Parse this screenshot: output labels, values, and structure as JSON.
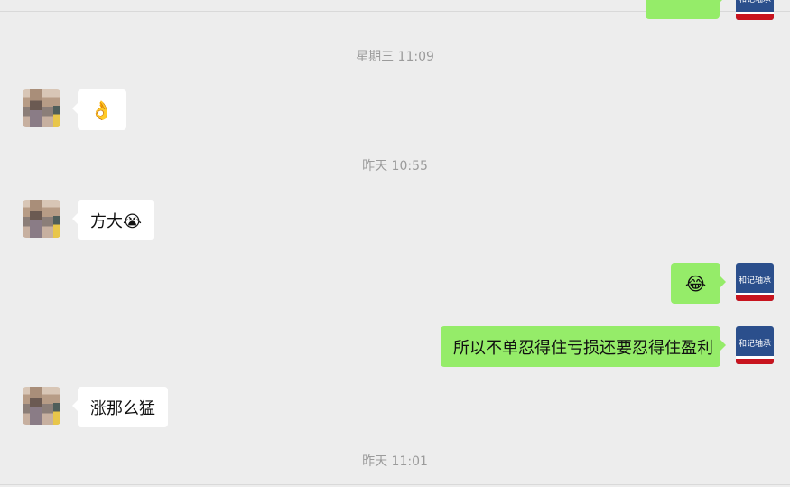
{
  "timestamps": [
    "星期三 11:09",
    "昨天 10:55",
    "昨天 11:01"
  ],
  "messages": [
    {
      "side": "left",
      "text": "👌",
      "type": "emoji"
    },
    {
      "side": "left",
      "text": "方大😭",
      "type": "text"
    },
    {
      "side": "right",
      "text": "😂",
      "type": "emoji"
    },
    {
      "side": "right",
      "text": "所以不单忍得住亏损还要忍得住盈利",
      "type": "text"
    },
    {
      "side": "left",
      "text": "涨那么猛",
      "type": "text"
    }
  ],
  "self_avatar": {
    "text": "和记轴承",
    "colors": {
      "bg": "#2b4f8c",
      "stripe": "#c8141e"
    }
  },
  "colors": {
    "background": "#ededed",
    "incoming_bubble": "#ffffff",
    "outgoing_bubble": "#95ec69",
    "time_text": "#9b9b9b"
  }
}
